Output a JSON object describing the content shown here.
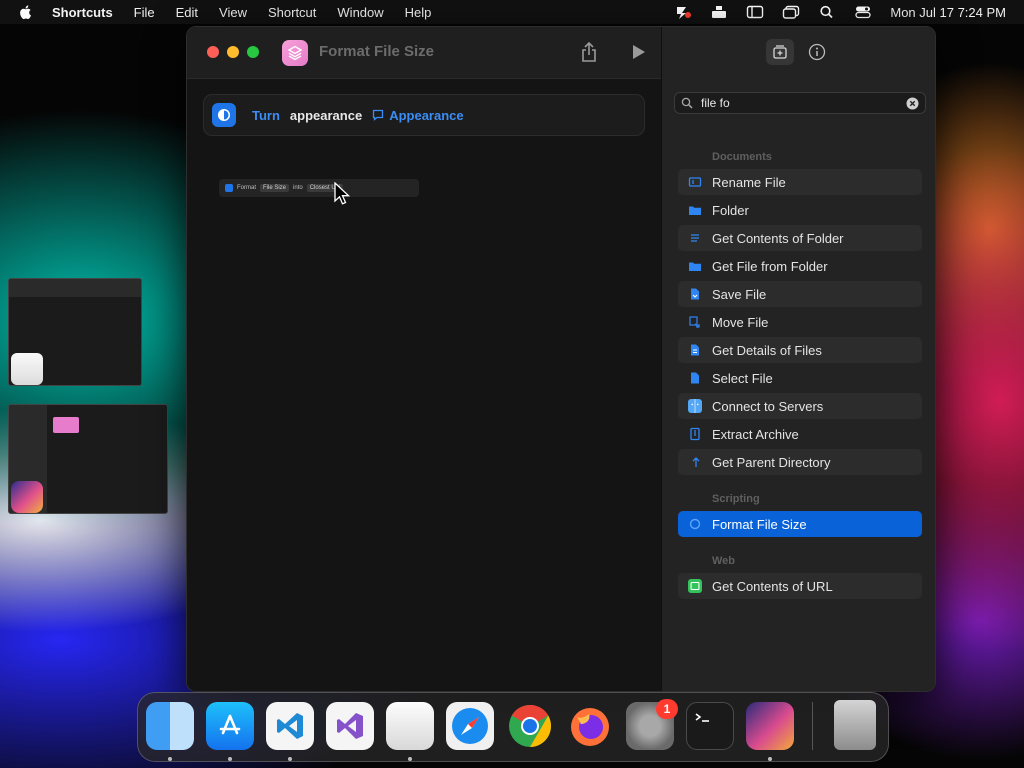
{
  "menubar": {
    "app_name": "Shortcuts",
    "items": [
      "File",
      "Edit",
      "View",
      "Shortcut",
      "Window",
      "Help"
    ],
    "clock": "Mon Jul 17  7:24 PM"
  },
  "window": {
    "title": "Format File Size",
    "action": {
      "verb": "Turn",
      "word": "appearance",
      "token": "Appearance"
    },
    "drag_preview": {
      "word1": "Format",
      "token1": "File Size",
      "word2": "into",
      "token2": "Closest Uni"
    }
  },
  "sidebar": {
    "search_value": "file fo",
    "sections": [
      {
        "label": "Documents",
        "items": [
          "Rename File",
          "Folder",
          "Get Contents of Folder",
          "Get File from Folder",
          "Save File",
          "Move File",
          "Get Details of Files",
          "Select File",
          "Connect to Servers",
          "Extract Archive",
          "Get Parent Directory"
        ]
      },
      {
        "label": "Scripting",
        "items": [
          "Format File Size"
        ]
      },
      {
        "label": "Web",
        "items": [
          "Get Contents of URL"
        ]
      }
    ]
  },
  "dock": {
    "badge": "1"
  },
  "colors": {
    "accent": "#0a62d8",
    "link": "#3a8df5",
    "shortcut_icon": "#e57bc9"
  }
}
